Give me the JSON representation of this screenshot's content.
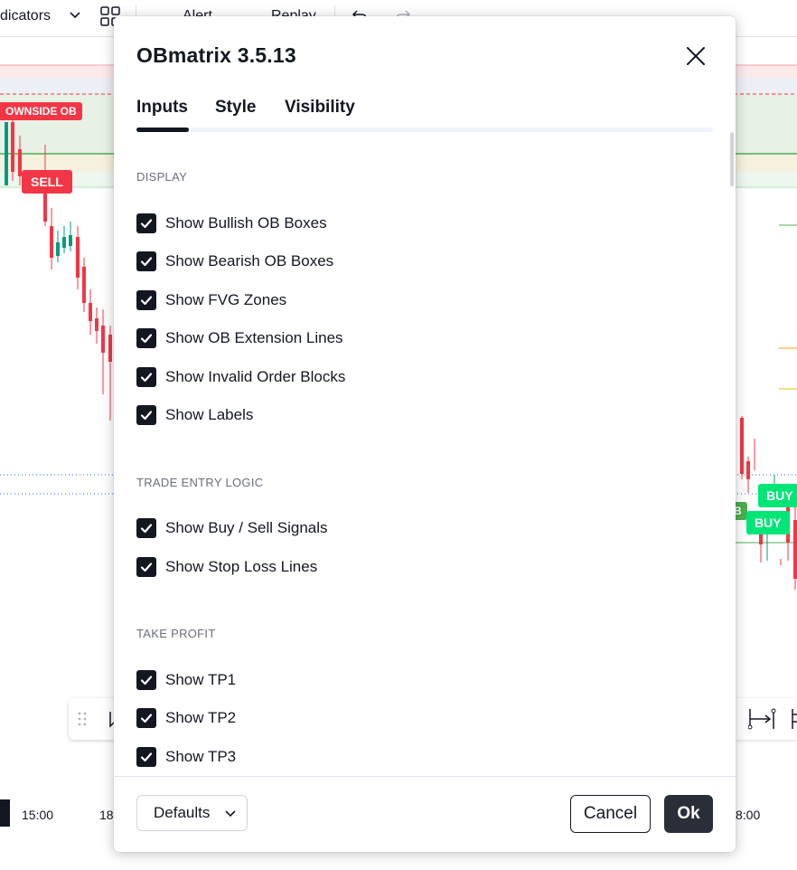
{
  "toolbar": {
    "indicators_label": "dicators",
    "alert_label": "Alert",
    "replay_label": "Replay"
  },
  "chart": {
    "labels": {
      "downside_ob": "OWNSIDE OB",
      "sell": "SELL",
      "buy_1": "BUY",
      "buy_2": "BUY",
      "partial_b": "B"
    },
    "time_axis": [
      "15:00",
      "18",
      "8:00"
    ]
  },
  "dialog": {
    "title": "OBmatrix 3.5.13",
    "tabs": [
      "Inputs",
      "Style",
      "Visibility"
    ],
    "active_tab": "Inputs",
    "sections": [
      {
        "title": "DISPLAY",
        "items": [
          {
            "label": "Show Bullish OB Boxes",
            "checked": true
          },
          {
            "label": "Show Bearish OB Boxes",
            "checked": true
          },
          {
            "label": "Show FVG Zones",
            "checked": true
          },
          {
            "label": "Show OB Extension Lines",
            "checked": true
          },
          {
            "label": "Show Invalid Order Blocks",
            "checked": true
          },
          {
            "label": "Show Labels",
            "checked": true
          }
        ]
      },
      {
        "title": "TRADE ENTRY LOGIC",
        "items": [
          {
            "label": "Show Buy / Sell Signals",
            "checked": true
          },
          {
            "label": "Show Stop Loss Lines",
            "checked": true
          }
        ]
      },
      {
        "title": "TAKE PROFIT",
        "items": [
          {
            "label": "Show TP1",
            "checked": true
          },
          {
            "label": "Show TP2",
            "checked": true
          },
          {
            "label": "Show TP3",
            "checked": true
          }
        ]
      }
    ],
    "footer": {
      "defaults_label": "Defaults",
      "cancel_label": "Cancel",
      "ok_label": "Ok"
    }
  },
  "colors": {
    "bull": "#089981",
    "bear": "#f23645",
    "buy_label": "#00e676",
    "dark": "#131722",
    "ok_bg": "#2a2e39"
  }
}
